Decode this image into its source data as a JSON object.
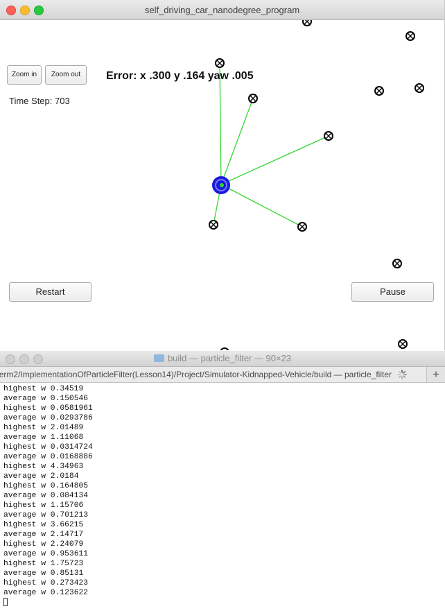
{
  "window": {
    "title": "self_driving_car_nanodegree_program",
    "buttons": {
      "zoom_in": "Zoom in",
      "zoom_out": "Zoom out",
      "restart": "Restart",
      "pause": "Pause"
    },
    "error_text": "Error: x .300 y .164 yaw .005",
    "time_step": "Time Step: 703",
    "colors": {
      "car": "#1a1adb",
      "ray": "#33d633",
      "landmark": "#000000"
    }
  },
  "terminal": {
    "title": "build — particle_filter — 90×23",
    "tab_label": "...erm2/ImplementationOfParticleFilter(Lesson14)/Project/Simulator-Kidnapped-Vehicle/build — particle_filter",
    "plus_label": "+",
    "lines": [
      "highest w 0.34519",
      "average w 0.150546",
      "highest w 0.0581961",
      "average w 0.0293786",
      "highest w 2.01489",
      "average w 1.11068",
      "highest w 0.0314724",
      "average w 0.0168886",
      "highest w 4.34963",
      "average w 2.0184",
      "highest w 0.164805",
      "average w 0.084134",
      "highest w 1.15706",
      "average w 0.701213",
      "highest w 3.66215",
      "average w 2.14717",
      "highest w 2.24079",
      "average w 0.953611",
      "highest w 1.75723",
      "average w 0.85131",
      "highest w 0.273423",
      "average w 0.123622"
    ]
  }
}
